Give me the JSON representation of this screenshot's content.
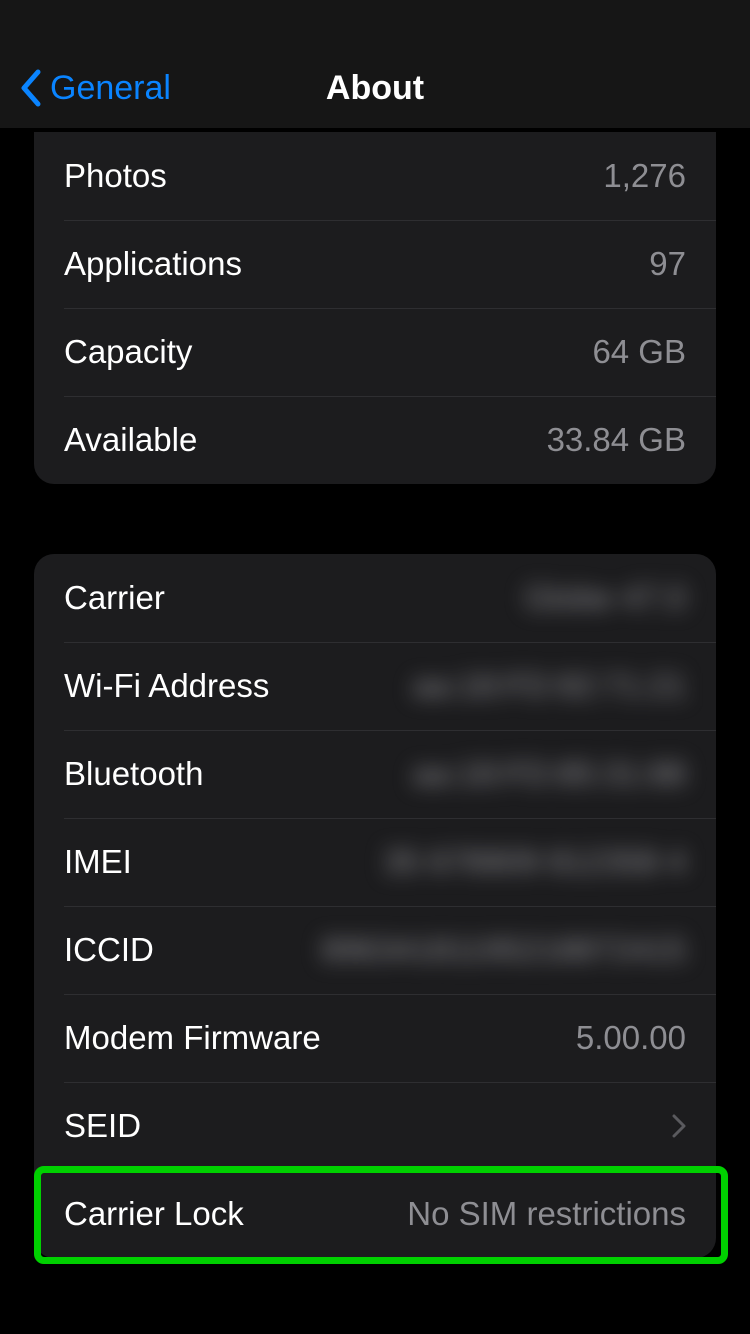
{
  "navbar": {
    "back_label": "General",
    "title": "About"
  },
  "group1": {
    "rows": [
      {
        "label": "Photos",
        "value": "1,276"
      },
      {
        "label": "Applications",
        "value": "97"
      },
      {
        "label": "Capacity",
        "value": "64 GB"
      },
      {
        "label": "Available",
        "value": "33.84 GB"
      }
    ]
  },
  "group2": {
    "rows": [
      {
        "label": "Carrier",
        "value": "Globe 47.0",
        "blurred": true
      },
      {
        "label": "Wi-Fi Address",
        "value": "aa:18:FD:92:71:21",
        "blurred": true
      },
      {
        "label": "Bluetooth",
        "value": "aa:18:FD:85:31:88",
        "blurred": true
      },
      {
        "label": "IMEI",
        "value": "35 678909 812358 4",
        "blurred": true
      },
      {
        "label": "ICCID",
        "value": "89634181195218872415",
        "blurred": true
      },
      {
        "label": "Modem Firmware",
        "value": "5.00.00"
      },
      {
        "label": "SEID",
        "value": "",
        "disclosure": true
      },
      {
        "label": "Carrier Lock",
        "value": "No SIM restrictions"
      }
    ]
  }
}
